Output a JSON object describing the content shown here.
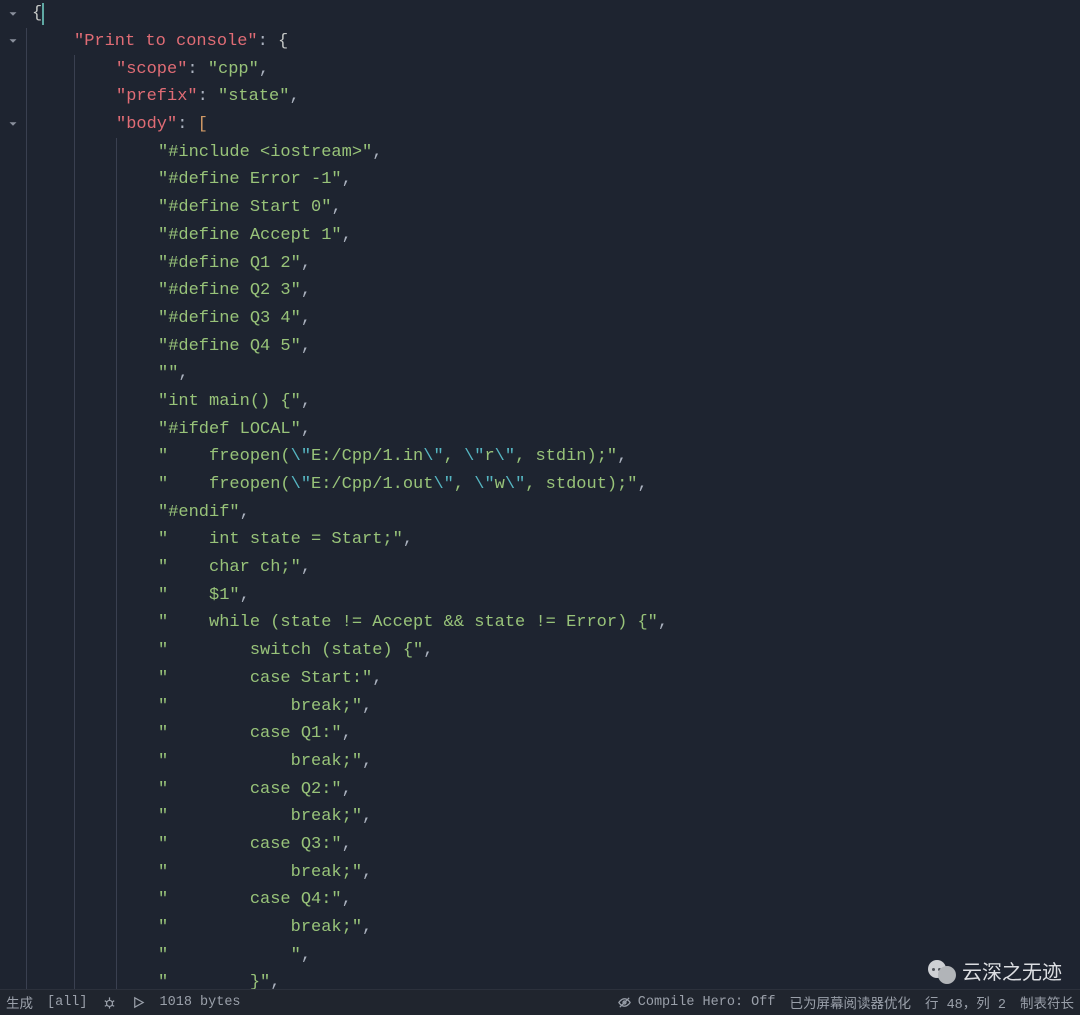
{
  "code": {
    "lines": [
      {
        "indent": 0,
        "tokens": [
          {
            "t": "{",
            "c": "brace"
          }
        ],
        "cursor_after_first": true
      },
      {
        "indent": 1,
        "tokens": [
          {
            "t": "\"Print to console\"",
            "c": "key"
          },
          {
            "t": ": ",
            "c": "colon"
          },
          {
            "t": "{",
            "c": "brace"
          }
        ]
      },
      {
        "indent": 2,
        "tokens": [
          {
            "t": "\"scope\"",
            "c": "key"
          },
          {
            "t": ": ",
            "c": "colon"
          },
          {
            "t": "\"cpp\"",
            "c": "string"
          },
          {
            "t": ",",
            "c": "punct"
          }
        ]
      },
      {
        "indent": 2,
        "tokens": [
          {
            "t": "\"prefix\"",
            "c": "key"
          },
          {
            "t": ": ",
            "c": "colon"
          },
          {
            "t": "\"state\"",
            "c": "string"
          },
          {
            "t": ",",
            "c": "punct"
          }
        ]
      },
      {
        "indent": 2,
        "tokens": [
          {
            "t": "\"body\"",
            "c": "key"
          },
          {
            "t": ": ",
            "c": "colon"
          },
          {
            "t": "[",
            "c": "bracket"
          }
        ]
      },
      {
        "indent": 3,
        "tokens": [
          {
            "t": "\"#include <iostream>\"",
            "c": "string"
          },
          {
            "t": ",",
            "c": "punct"
          }
        ]
      },
      {
        "indent": 3,
        "tokens": [
          {
            "t": "\"#define Error -1\"",
            "c": "string"
          },
          {
            "t": ",",
            "c": "punct"
          }
        ]
      },
      {
        "indent": 3,
        "tokens": [
          {
            "t": "\"#define Start 0\"",
            "c": "string"
          },
          {
            "t": ",",
            "c": "punct"
          }
        ]
      },
      {
        "indent": 3,
        "tokens": [
          {
            "t": "\"#define Accept 1\"",
            "c": "string"
          },
          {
            "t": ",",
            "c": "punct"
          }
        ]
      },
      {
        "indent": 3,
        "tokens": [
          {
            "t": "\"#define Q1 2\"",
            "c": "string"
          },
          {
            "t": ",",
            "c": "punct"
          }
        ]
      },
      {
        "indent": 3,
        "tokens": [
          {
            "t": "\"#define Q2 3\"",
            "c": "string"
          },
          {
            "t": ",",
            "c": "punct"
          }
        ]
      },
      {
        "indent": 3,
        "tokens": [
          {
            "t": "\"#define Q3 4\"",
            "c": "string"
          },
          {
            "t": ",",
            "c": "punct"
          }
        ]
      },
      {
        "indent": 3,
        "tokens": [
          {
            "t": "\"#define Q4 5\"",
            "c": "string"
          },
          {
            "t": ",",
            "c": "punct"
          }
        ]
      },
      {
        "indent": 3,
        "tokens": [
          {
            "t": "\"\"",
            "c": "string"
          },
          {
            "t": ",",
            "c": "punct"
          }
        ]
      },
      {
        "indent": 3,
        "tokens": [
          {
            "t": "\"int main() {\"",
            "c": "string"
          },
          {
            "t": ",",
            "c": "punct"
          }
        ]
      },
      {
        "indent": 3,
        "tokens": [
          {
            "t": "\"#ifdef LOCAL\"",
            "c": "string"
          },
          {
            "t": ",",
            "c": "punct"
          }
        ]
      },
      {
        "indent": 3,
        "tokens": [
          {
            "t": "\"    freopen(",
            "c": "string"
          },
          {
            "t": "\\\"",
            "c": "escape"
          },
          {
            "t": "E:/Cpp/1.in",
            "c": "string"
          },
          {
            "t": "\\\"",
            "c": "escape"
          },
          {
            "t": ", ",
            "c": "string"
          },
          {
            "t": "\\\"",
            "c": "escape"
          },
          {
            "t": "r",
            "c": "string"
          },
          {
            "t": "\\\"",
            "c": "escape"
          },
          {
            "t": ", stdin);\"",
            "c": "string"
          },
          {
            "t": ",",
            "c": "punct"
          }
        ]
      },
      {
        "indent": 3,
        "tokens": [
          {
            "t": "\"    freopen(",
            "c": "string"
          },
          {
            "t": "\\\"",
            "c": "escape"
          },
          {
            "t": "E:/Cpp/1.out",
            "c": "string"
          },
          {
            "t": "\\\"",
            "c": "escape"
          },
          {
            "t": ", ",
            "c": "string"
          },
          {
            "t": "\\\"",
            "c": "escape"
          },
          {
            "t": "w",
            "c": "string"
          },
          {
            "t": "\\\"",
            "c": "escape"
          },
          {
            "t": ", stdout);\"",
            "c": "string"
          },
          {
            "t": ",",
            "c": "punct"
          }
        ]
      },
      {
        "indent": 3,
        "tokens": [
          {
            "t": "\"#endif\"",
            "c": "string"
          },
          {
            "t": ",",
            "c": "punct"
          }
        ]
      },
      {
        "indent": 3,
        "tokens": [
          {
            "t": "\"    int state = Start;\"",
            "c": "string"
          },
          {
            "t": ",",
            "c": "punct"
          }
        ]
      },
      {
        "indent": 3,
        "tokens": [
          {
            "t": "\"    char ch;\"",
            "c": "string"
          },
          {
            "t": ",",
            "c": "punct"
          }
        ]
      },
      {
        "indent": 3,
        "tokens": [
          {
            "t": "\"    $1\"",
            "c": "string"
          },
          {
            "t": ",",
            "c": "punct"
          }
        ]
      },
      {
        "indent": 3,
        "tokens": [
          {
            "t": "\"    while (state != Accept && state != Error) {\"",
            "c": "string"
          },
          {
            "t": ",",
            "c": "punct"
          }
        ]
      },
      {
        "indent": 3,
        "tokens": [
          {
            "t": "\"        switch (state) {\"",
            "c": "string"
          },
          {
            "t": ",",
            "c": "punct"
          }
        ]
      },
      {
        "indent": 3,
        "tokens": [
          {
            "t": "\"        case Start:\"",
            "c": "string"
          },
          {
            "t": ",",
            "c": "punct"
          }
        ]
      },
      {
        "indent": 3,
        "tokens": [
          {
            "t": "\"            break;\"",
            "c": "string"
          },
          {
            "t": ",",
            "c": "punct"
          }
        ]
      },
      {
        "indent": 3,
        "tokens": [
          {
            "t": "\"        case Q1:\"",
            "c": "string"
          },
          {
            "t": ",",
            "c": "punct"
          }
        ]
      },
      {
        "indent": 3,
        "tokens": [
          {
            "t": "\"            break;\"",
            "c": "string"
          },
          {
            "t": ",",
            "c": "punct"
          }
        ]
      },
      {
        "indent": 3,
        "tokens": [
          {
            "t": "\"        case Q2:\"",
            "c": "string"
          },
          {
            "t": ",",
            "c": "punct"
          }
        ]
      },
      {
        "indent": 3,
        "tokens": [
          {
            "t": "\"            break;\"",
            "c": "string"
          },
          {
            "t": ",",
            "c": "punct"
          }
        ]
      },
      {
        "indent": 3,
        "tokens": [
          {
            "t": "\"        case Q3:\"",
            "c": "string"
          },
          {
            "t": ",",
            "c": "punct"
          }
        ]
      },
      {
        "indent": 3,
        "tokens": [
          {
            "t": "\"            break;\"",
            "c": "string"
          },
          {
            "t": ",",
            "c": "punct"
          }
        ]
      },
      {
        "indent": 3,
        "tokens": [
          {
            "t": "\"        case Q4:\"",
            "c": "string"
          },
          {
            "t": ",",
            "c": "punct"
          }
        ]
      },
      {
        "indent": 3,
        "tokens": [
          {
            "t": "\"            break;\"",
            "c": "string"
          },
          {
            "t": ",",
            "c": "punct"
          }
        ]
      },
      {
        "indent": 3,
        "tokens": [
          {
            "t": "\"            \"",
            "c": "string"
          },
          {
            "t": ",",
            "c": "punct"
          }
        ]
      },
      {
        "indent": 3,
        "tokens": [
          {
            "t": "\"        }\"",
            "c": "string"
          },
          {
            "t": ",",
            "c": "punct"
          }
        ]
      }
    ],
    "fold_markers": [
      0,
      1,
      4
    ]
  },
  "statusbar": {
    "left": [
      {
        "id": "generate",
        "label": "生成"
      },
      {
        "id": "scope",
        "label": "[all]"
      },
      {
        "id": "debug",
        "icon": "bug"
      },
      {
        "id": "run",
        "icon": "play"
      },
      {
        "id": "size",
        "label": "1018 bytes"
      }
    ],
    "right": [
      {
        "id": "compile-hero",
        "icon": "eye-off",
        "label": "Compile Hero: Off"
      },
      {
        "id": "screen-reader",
        "label": "已为屏幕阅读器优化"
      },
      {
        "id": "cursor-pos",
        "label": "行 48，列 2"
      },
      {
        "id": "tab-size",
        "label": "制表符长"
      }
    ]
  },
  "watermark": {
    "text": "云深之无迹"
  }
}
